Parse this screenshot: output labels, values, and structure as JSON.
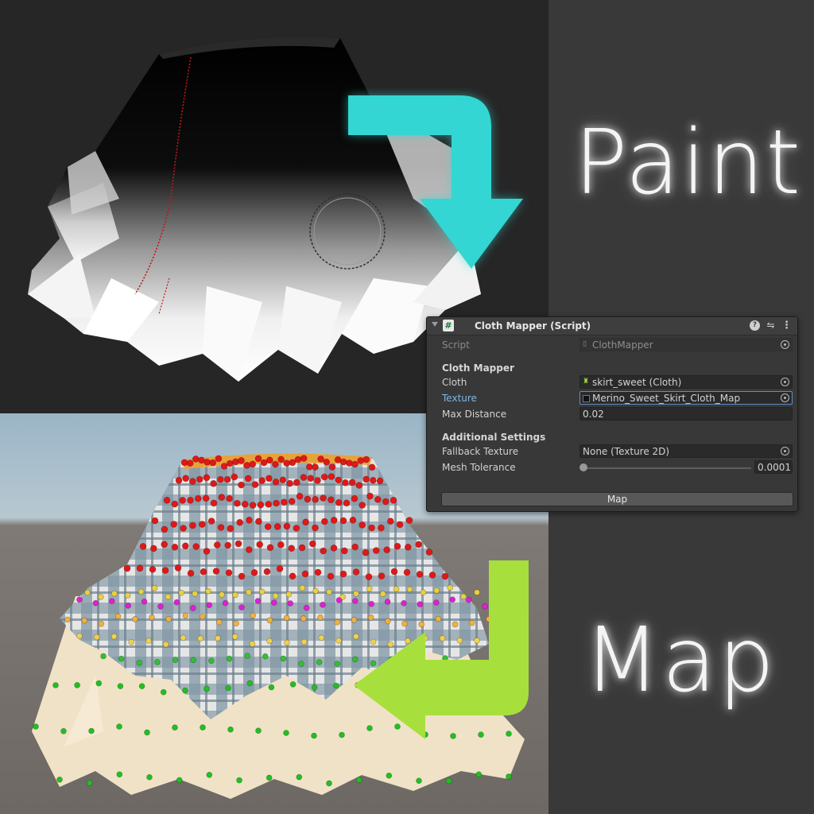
{
  "labels": {
    "paint": "Paint",
    "map": "Map"
  },
  "colors": {
    "paint_arrow": "#33d6d2",
    "map_arrow": "#a7e03c"
  },
  "inspector": {
    "title": "Cloth Mapper (Script)",
    "header_icons": [
      "help-icon",
      "preset-icon",
      "more-icon"
    ],
    "script_label": "Script",
    "script_value": "ClothMapper",
    "section_cloth_mapper": "Cloth Mapper",
    "cloth_label": "Cloth",
    "cloth_value": "skirt_sweet (Cloth)",
    "texture_label": "Texture",
    "texture_value": "Merino_Sweet_Skirt_Cloth_Map",
    "max_distance_label": "Max Distance",
    "max_distance_value": "0.02",
    "section_additional": "Additional Settings",
    "fallback_texture_label": "Fallback Texture",
    "fallback_texture_value": "None (Texture 2D)",
    "mesh_tolerance_label": "Mesh Tolerance",
    "mesh_tolerance_value": "0.0001",
    "map_button_label": "Map"
  }
}
